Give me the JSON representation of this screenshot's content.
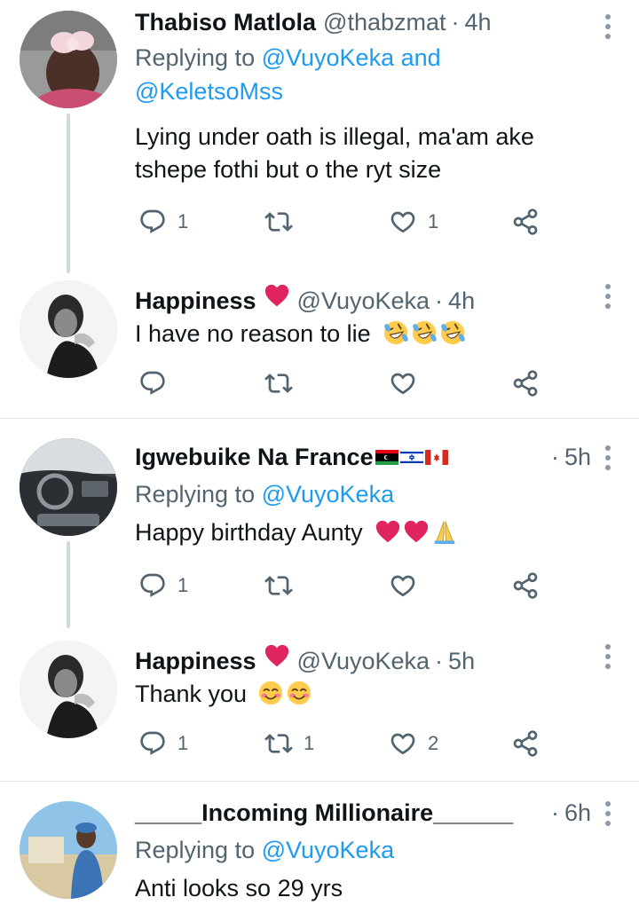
{
  "tweets": [
    {
      "name": "Thabiso Matlola",
      "handle": "@thabzmat",
      "time": "4h",
      "replying_prefix": "Replying to ",
      "replying_mentions": "@VuyoKeka and",
      "replying_mentions2": "@KeletsoMss",
      "text1": "Lying under oath is illegal, ma'am ake",
      "text2": "tshepe fothi but o the ryt size",
      "reply_count": "1",
      "retweet_count": "",
      "like_count": "1"
    },
    {
      "name": "Happiness",
      "handle": "@VuyoKeka",
      "time": "4h",
      "text1": "I have no reason to lie",
      "reply_count": "",
      "retweet_count": "",
      "like_count": ""
    },
    {
      "name": "Igwebuike Na France",
      "time": "5h",
      "replying_prefix": "Replying to ",
      "replying_mentions": "@VuyoKeka",
      "text1": "Happy birthday Aunty",
      "reply_count": "1",
      "retweet_count": "",
      "like_count": ""
    },
    {
      "name": "Happiness",
      "handle": "@VuyoKeka",
      "time": "5h",
      "text1": "Thank you",
      "reply_count": "1",
      "retweet_count": "1",
      "like_count": "2"
    },
    {
      "name": "_____Incoming Millionaire______",
      "time": "6h",
      "replying_prefix": "Replying to ",
      "replying_mentions": "@VuyoKeka",
      "text1": "Anti looks so 29 yrs"
    }
  ],
  "separator": "·",
  "colors": {
    "accent": "#1d9bf0",
    "muted": "#536471",
    "heart": "#e0245e"
  }
}
